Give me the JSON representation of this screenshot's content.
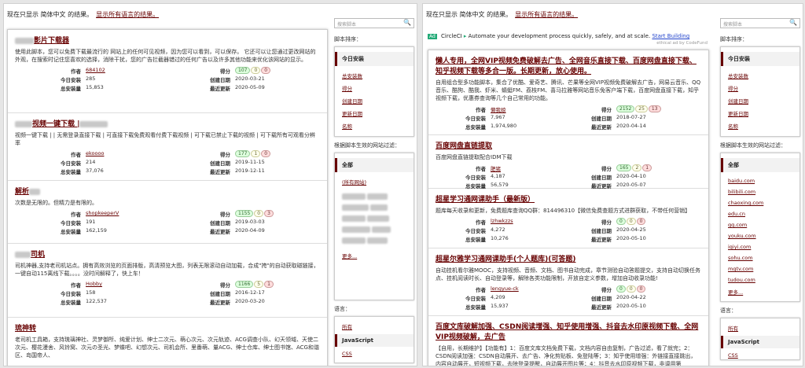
{
  "notice": {
    "text": "现在只显示 简体中文 的结果。",
    "link": "显示所有语言的结果。"
  },
  "search": {
    "placeholder": "搜索脚本"
  },
  "labels": {
    "author": "作者",
    "daily": "今日安装",
    "total": "总安装量",
    "score": "得分",
    "created": "创建日期",
    "updated": "最近更新"
  },
  "sidebar": {
    "sort_title": "脚本排序：",
    "sort_current": "今日安装",
    "sort_links": [
      "总安装数",
      "得分",
      "创建日期",
      "更新日期",
      "名称"
    ],
    "filter_title": "根据脚本生效的网站过滤：",
    "filter_current": "全部",
    "left_filter_links": [
      "(所有网站)"
    ],
    "left_more": "更多...",
    "right_filter_links": [
      "baidu.com",
      "bilibili.com",
      "chaoxing.com",
      "edu.cn",
      "qq.com",
      "youku.com",
      "iqiyi.com",
      "sohu.com",
      "mgtv.com",
      "tudou.com",
      "更多..."
    ],
    "lang_title": "语言：",
    "lang_all": "所有",
    "lang_current": "JavaScript",
    "lang_css": "CSS"
  },
  "left_entries": [
    {
      "title": "影片下载器",
      "desc": "使用此脚本，您可以免费下载最流行的 网站上的任何可见视频，因为您可以看到，可以保存。 它还可以让您通过更改网站的外观，在搜索时记住您喜欢的选择，消除干扰，您的广告拦截器错过的任何广告以及许多其他功能来优化该网站的显示。",
      "author": "684102",
      "daily": "285",
      "total": "15,853",
      "scores": [
        "107",
        "0",
        "0"
      ],
      "created": "2020-03-21",
      "updated": "2020-05-09"
    },
    {
      "title": "视频一键下载 |",
      "desc": "视频一键下载 | | 无需登录直接下载 | 可直接下载免费观看付费下载视频 | 可下载已禁止下载的视频 | 可下载所有可观看分辨率",
      "author": "ekoooo",
      "daily": "214",
      "total": "37,076",
      "scores": [
        "177",
        "1",
        "0"
      ],
      "created": "2019-11-15",
      "updated": "2019-12-11"
    },
    {
      "title": "解析",
      "desc": "次数是无限的。但精力是有限的。",
      "author": "shopkeeperV",
      "daily": "191",
      "total": "162,159",
      "scores": [
        "1155",
        "0",
        "3"
      ],
      "created": "2019-03-03",
      "updated": "2020-04-09"
    },
    {
      "title": "司机",
      "desc": "司机神器,支持老司机站点。拥有高效浏览的页面排版，高清预览大图，列表无限滚动自动加载，合成\"挎\"的自动获取磁链接，一键自动115离线下载。。。。没时间解释了，快上车！",
      "author": "Hobby",
      "daily": "158",
      "total": "122,537",
      "scores": [
        "1166",
        "5",
        "1"
      ],
      "created": "2016-12-17",
      "updated": "2020-03-20"
    },
    {
      "title": "琉神转",
      "desc": "老司机工具箱，支持琉璃神社、灵梦御所、纯爱计划、绅士二次元、萌心次元、次元轨迹、ACG调查小队、幻天领域、天使二次元、樱花漫舍、风铃窝、次元の圣光、梦蝶吧、幻想次元、司机会所、里番萌、量ACG、绅士仓库、绅士图书馆、ACG和谐区、岛国帝人、"
    }
  ],
  "ad": {
    "badge": "Ad",
    "name": "CircleCI",
    "text": "Automate your development process quickly, safely, and at scale.",
    "link": "Start Building",
    "ethical": "ethical ad by CodeFund"
  },
  "right_entries": [
    {
      "title": "懒人专用，全网VIP视频免费破解去广告、全网音乐直接下载、百度网盘直接下载、知乎视频下载等多合一版。长期更新，放心使用。",
      "desc": "自用组合型多功能脚本，集合了优酷、爱奇艺、腾讯、芒果等全网VIP视频免费破解去广告，网易云音乐、QQ音乐、酷狗、酷我、虾米、蜻蜓FM、荔枝FM、喜马拉雅等网站音乐免客户端下载，百度网盘直接下载，知乎视频下载，优惠券查询等几个自己常用的功能。",
      "author": "懒我娘",
      "daily": "7,967",
      "total": "1,974,980",
      "scores": [
        "2152",
        "25",
        "13"
      ],
      "created": "2018-07-27",
      "updated": "2020-04-14"
    },
    {
      "title": "百度网盘直链提取",
      "desc": "百度网盘直链提取配合IDM下载",
      "author": "肥猪",
      "daily": "4,187",
      "total": "56,579",
      "scores": [
        "165",
        "2",
        "1"
      ],
      "created": "2020-04-10",
      "updated": "2020-05-07"
    },
    {
      "title": "超星学习通网课助手（最新版）",
      "desc": "题库每天收录和更新，免费题库查询QQ群：814496310【微信免费查题方式进群获取，不带任何营销】",
      "author": "lzhwkzzs",
      "daily": "4,272",
      "total": "10,276",
      "scores": [
        "0",
        "0",
        "0"
      ],
      "created": "2020-04-25",
      "updated": "2020-05-10"
    },
    {
      "title": "超星尔雅学习通网课助手(个人题库)(可答题)",
      "desc": "自动挂机看尔雅MOOC，支持视频、音频、文档、图书自动完成，章节测验自动答题提交，支持自动切换任务点、挂机阅读时长、自动登录等，解除各类功能限制，开放自定义参数，增加自动收录功能!",
      "author": "lengyue-ck",
      "daily": "4,209",
      "total": "15,937",
      "scores": [
        "0",
        "0",
        "0"
      ],
      "created": "2020-04-22",
      "updated": "2020-05-10"
    },
    {
      "title": "百度文库破解加强、CSDN阅读增强、知乎使用增强、抖音去水印原视频下载、全网VIP视频破解，去广告",
      "desc": "【自用，长期维护】【功能有】1：百度文库文档免费下载，文档内容自由复制，广告过滤，看了就完；2：CSDN阅读加强：CSDN自动展开、去广告、净化剪贴板、免登陆等；3：知乎使用增强：外链接直接跳出，内容自动展开，短视频下载，去除登录提醒，自动展开图片等；4：抖音去水印原视频下载，非调用第"
    }
  ]
}
